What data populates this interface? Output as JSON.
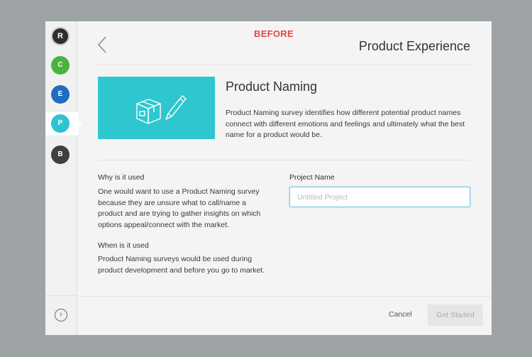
{
  "banner": {
    "label": "BEFORE"
  },
  "header": {
    "title": "Product Experience"
  },
  "sidebar": {
    "items": [
      {
        "letter": "R",
        "name": "r"
      },
      {
        "letter": "C",
        "name": "c"
      },
      {
        "letter": "E",
        "name": "e"
      },
      {
        "letter": "P",
        "name": "p"
      },
      {
        "letter": "B",
        "name": "b"
      }
    ]
  },
  "product": {
    "title": "Product Naming",
    "description": "Product Naming survey identifies how different potential product names connect with different emotions and feelings and ultimately what the best name for a product would be."
  },
  "why": {
    "heading": "Why is it used",
    "text": "One would want to use a Product Naming survey because they are unsure what to call/name a product and are trying to gather insights on which options appeal/connect with the market."
  },
  "when": {
    "heading": "When is it used",
    "text": "Product Naming surveys would be used during product development and before you go to market."
  },
  "project": {
    "label": "Project Name",
    "placeholder": "Untitled Project",
    "value": ""
  },
  "footer": {
    "cancel_label": "Cancel",
    "start_label": "Get Started"
  },
  "colors": {
    "accent": "#2ec7cf",
    "banner": "#e34848",
    "background": "#9ea3a6"
  }
}
